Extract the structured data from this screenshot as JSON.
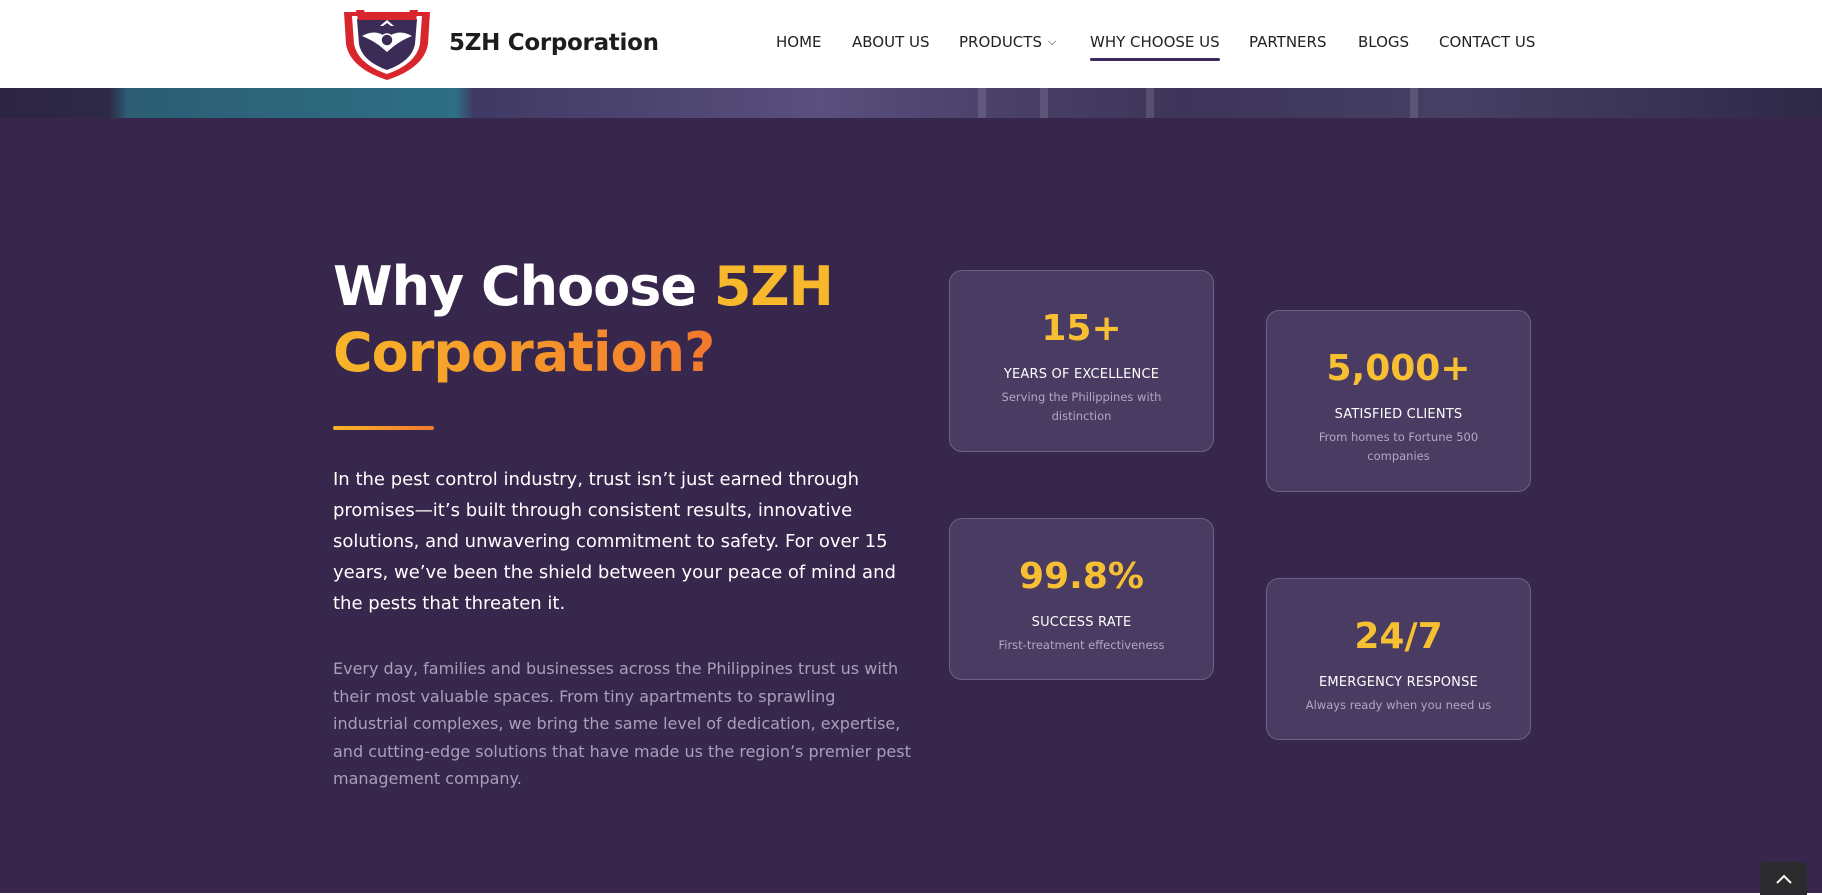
{
  "brand": {
    "name": "5ZH Corporation",
    "logo_icon": "shield-eagle-logo"
  },
  "nav": {
    "items": [
      {
        "label": "HOME"
      },
      {
        "label": "ABOUT US"
      },
      {
        "label": "PRODUCTS",
        "has_dropdown": true
      },
      {
        "label": "WHY CHOOSE US",
        "active": true
      },
      {
        "label": "PARTNERS"
      },
      {
        "label": "BLOGS"
      },
      {
        "label": "CONTACT US"
      }
    ],
    "dropdown_icon": "chevron-down-icon"
  },
  "section": {
    "title_part1": "Why Choose ",
    "title_part2": "5ZH",
    "title_part3": "Corporation?",
    "lead": "In the pest control industry, trust isn’t just earned through promises—it’s built through consistent results, innovative solutions, and unwavering commitment to safety. For over 15 years, we’ve been the shield between your peace of mind and the pests that threaten it.",
    "body": "Every day, families and businesses across the Philippines trust us with their most valuable spaces. From tiny apartments to sprawling industrial complexes, we bring the same level of dedication, expertise, and cutting-edge solutions that have made us the region’s premier pest management company."
  },
  "stats": [
    {
      "value": "15+",
      "label": "YEARS OF EXCELLENCE",
      "desc": "Serving the Philippines with distinction"
    },
    {
      "value": "5,000+",
      "label": "SATISFIED CLIENTS",
      "desc": "From homes to Fortune 500 companies"
    },
    {
      "value": "99.8%",
      "label": "SUCCESS RATE",
      "desc": "First-treatment effectiveness"
    },
    {
      "value": "24/7",
      "label": "EMERGENCY RESPONSE",
      "desc": "Always ready when you need us"
    }
  ],
  "colors": {
    "section_bg": "#38274d",
    "card_bg": "#4a3b62",
    "accent_yellow": "#f7c033",
    "accent_orange": "#f2782c"
  },
  "scroll_top_icon": "chevron-up-icon"
}
